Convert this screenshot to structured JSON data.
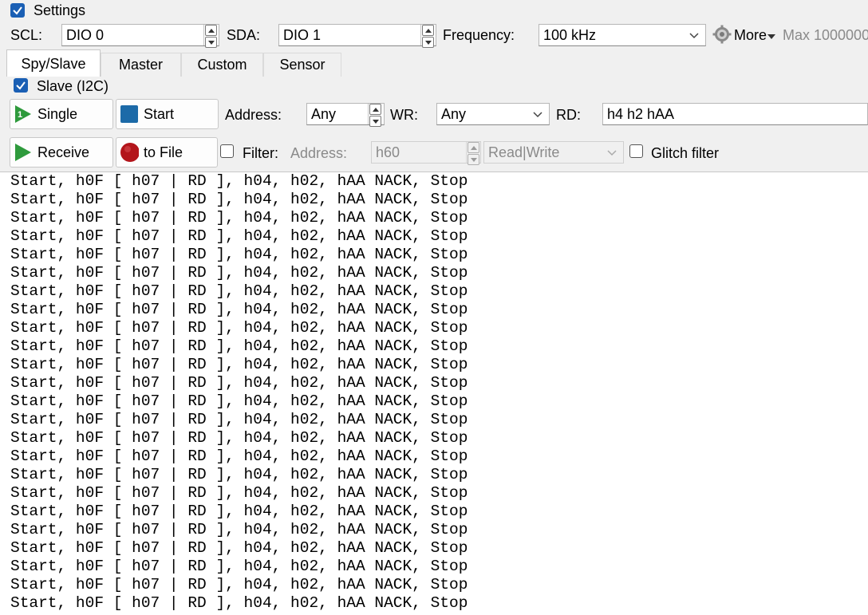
{
  "settings": {
    "label": "Settings",
    "checked": true
  },
  "scl": {
    "label": "SCL:",
    "value": "DIO 0"
  },
  "sda": {
    "label": "SDA:",
    "value": "DIO 1"
  },
  "frequency": {
    "label": "Frequency:",
    "value": "100 kHz"
  },
  "more": {
    "label": "More",
    "max_text": "Max 1000000"
  },
  "tabs": [
    {
      "label": "Spy/Slave",
      "active": true
    },
    {
      "label": "Master"
    },
    {
      "label": "Custom"
    },
    {
      "label": "Sensor"
    }
  ],
  "slave": {
    "label": "Slave (I2C)",
    "checked": true,
    "single_label": "Single",
    "start_label": "Start",
    "address_label": "Address:",
    "address_value": "Any",
    "wr_label": "WR:",
    "wr_value": "Any",
    "rd_label": "RD:",
    "rd_value": "h4 h2 hAA"
  },
  "receive": {
    "receive_label": "Receive",
    "tofile_label": "to File",
    "filter_label": "Filter:",
    "filter_address_label": "Address:",
    "filter_address_value": "h60",
    "filter_mode": "Read|Write",
    "glitch_label": "Glitch filter"
  },
  "log": {
    "lines": [
      "Start, h0F [ h07 | RD ], h04, h02, hAA NACK, Stop",
      "Start, h0F [ h07 | RD ], h04, h02, hAA NACK, Stop",
      "Start, h0F [ h07 | RD ], h04, h02, hAA NACK, Stop",
      "Start, h0F [ h07 | RD ], h04, h02, hAA NACK, Stop",
      "Start, h0F [ h07 | RD ], h04, h02, hAA NACK, Stop",
      "Start, h0F [ h07 | RD ], h04, h02, hAA NACK, Stop",
      "Start, h0F [ h07 | RD ], h04, h02, hAA NACK, Stop",
      "Start, h0F [ h07 | RD ], h04, h02, hAA NACK, Stop",
      "Start, h0F [ h07 | RD ], h04, h02, hAA NACK, Stop",
      "Start, h0F [ h07 | RD ], h04, h02, hAA NACK, Stop",
      "Start, h0F [ h07 | RD ], h04, h02, hAA NACK, Stop",
      "Start, h0F [ h07 | RD ], h04, h02, hAA NACK, Stop",
      "Start, h0F [ h07 | RD ], h04, h02, hAA NACK, Stop",
      "Start, h0F [ h07 | RD ], h04, h02, hAA NACK, Stop",
      "Start, h0F [ h07 | RD ], h04, h02, hAA NACK, Stop",
      "Start, h0F [ h07 | RD ], h04, h02, hAA NACK, Stop",
      "Start, h0F [ h07 | RD ], h04, h02, hAA NACK, Stop",
      "Start, h0F [ h07 | RD ], h04, h02, hAA NACK, Stop",
      "Start, h0F [ h07 | RD ], h04, h02, hAA NACK, Stop",
      "Start, h0F [ h07 | RD ], h04, h02, hAA NACK, Stop",
      "Start, h0F [ h07 | RD ], h04, h02, hAA NACK, Stop",
      "Start, h0F [ h07 | RD ], h04, h02, hAA NACK, Stop",
      "Start, h0F [ h07 | RD ], h04, h02, hAA NACK, Stop",
      "Start, h0F [ h07 | RD ], h04, h02, hAA NACK, Stop"
    ]
  },
  "colors": {
    "checkbox": "#1a5fb4",
    "play_green": "#2e9a3c",
    "stop_blue": "#1c6aa8",
    "record_red": "#b3151b"
  }
}
